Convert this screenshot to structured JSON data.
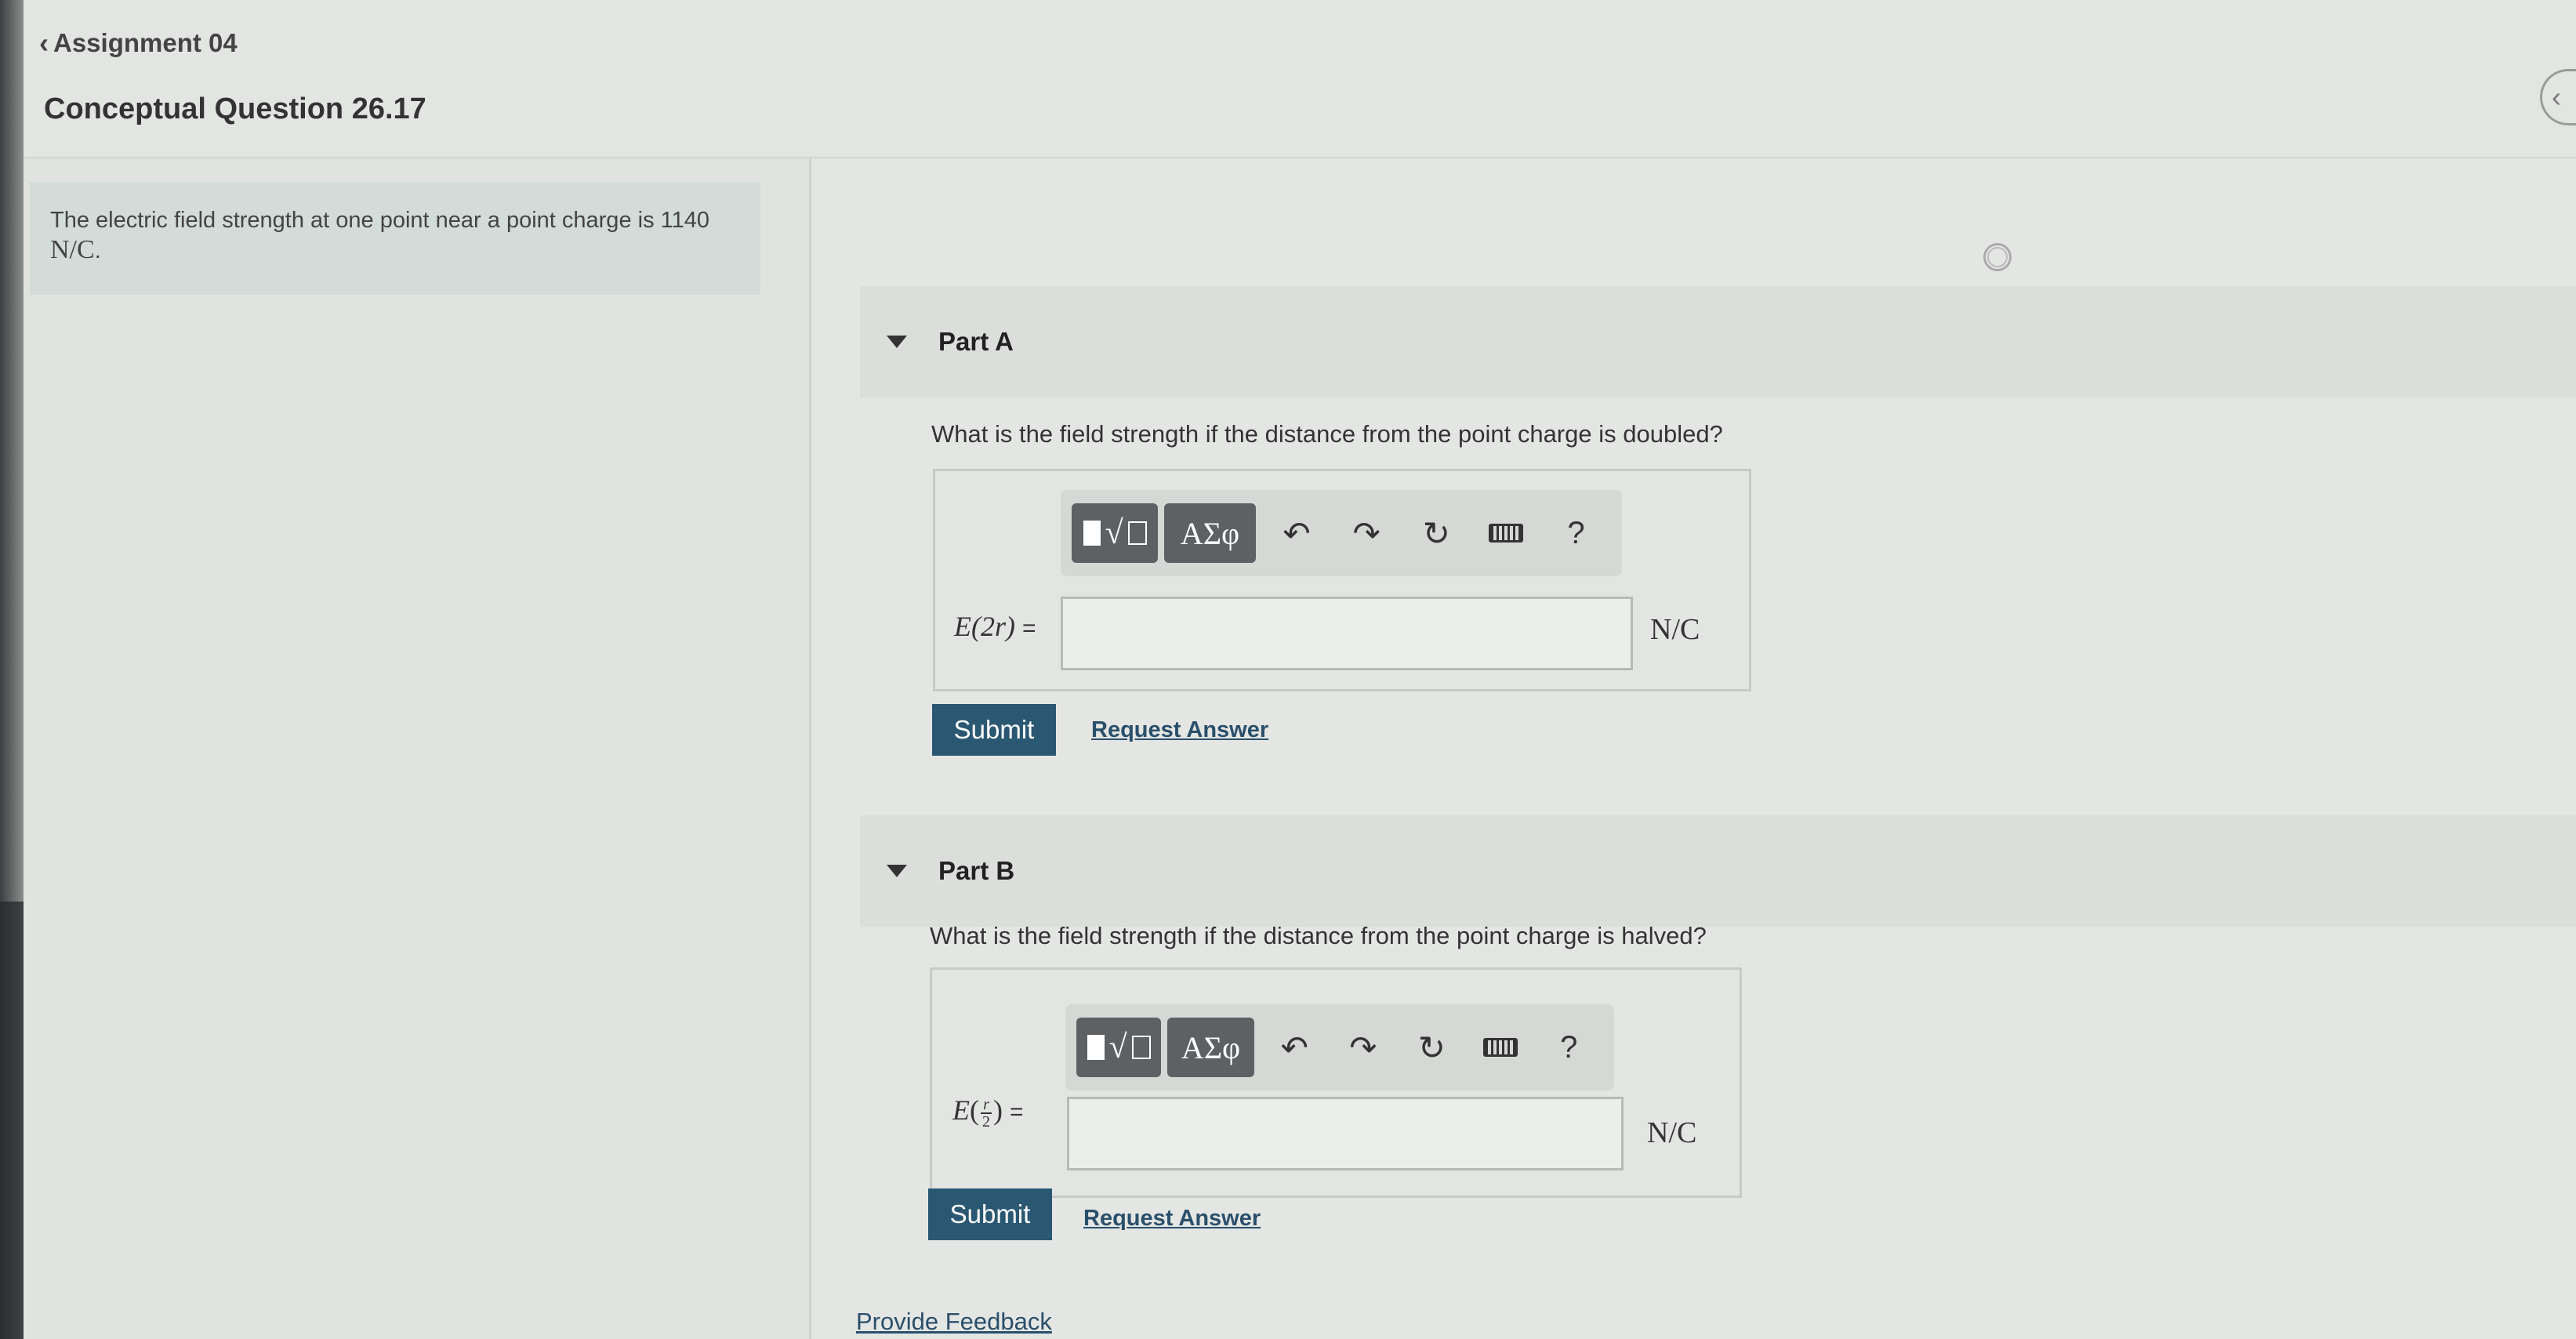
{
  "header": {
    "back_label": "Assignment 04",
    "title": "Conceptual Question 26.17"
  },
  "intro": {
    "text": "The electric field strength at one point near a point charge is 1140",
    "unit": "N/C",
    "period": "."
  },
  "toolbar": {
    "greek_label": "ΑΣφ",
    "help_label": "?"
  },
  "partA": {
    "label": "Part A",
    "question": "What is the field strength if the distance from the point charge is doubled?",
    "eq_label": "E(2r)",
    "eq_sign": "=",
    "input_value": "",
    "unit": "N/C",
    "submit_label": "Submit",
    "request_label": "Request Answer"
  },
  "partB": {
    "label": "Part B",
    "question": "What is the field strength if the distance from the point charge is halved?",
    "eq_E": "E",
    "eq_r": "r",
    "eq_2": "2",
    "eq_sign": "=",
    "input_value": "",
    "unit": "N/C",
    "submit_label": "Submit",
    "request_label": "Request Answer"
  },
  "footer": {
    "feedback_label": "Provide Feedback"
  },
  "icons": {
    "back": "chevron-left-icon",
    "template": "fraction-sqrt-template-icon",
    "undo": "undo-icon",
    "redo": "redo-icon",
    "reset": "reset-icon",
    "keyboard": "keyboard-icon",
    "help": "help-icon",
    "collapse": "chevron-left-icon",
    "status": "status-circle-icon"
  }
}
